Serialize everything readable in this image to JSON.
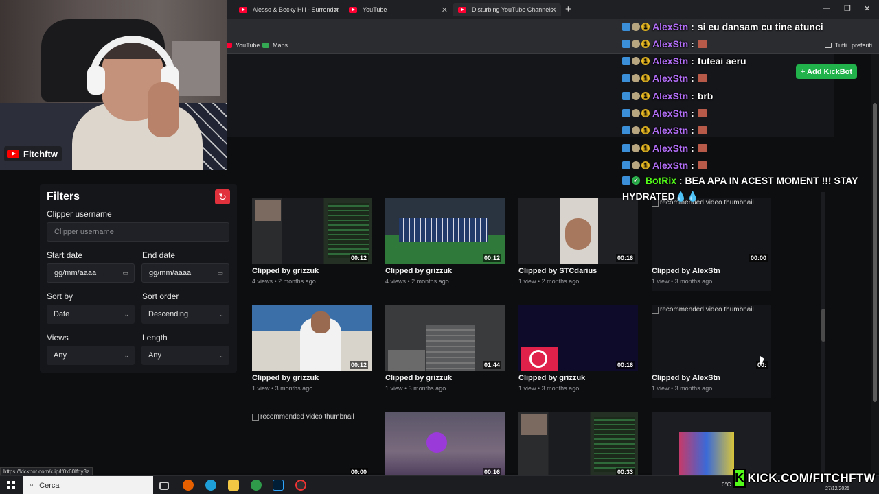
{
  "browser": {
    "tabs": [
      {
        "title": "Alesso & Becky Hill - Surrender"
      },
      {
        "title": "YouTube"
      },
      {
        "title": "Disturbing YouTube Channels I"
      }
    ],
    "bookmarks": [
      {
        "label": "YouTube"
      },
      {
        "label": "Maps"
      }
    ],
    "all_bookmarks": "Tutti i preferiti"
  },
  "webcam": {
    "channel_name": "Fitchftw"
  },
  "chat": {
    "messages": [
      {
        "user": "AlexStn",
        "text": "si eu dansam cu tine atunci",
        "emote": false
      },
      {
        "user": "AlexStn",
        "text": "",
        "emote": true
      },
      {
        "user": "AlexStn",
        "text": "futeai aeru",
        "emote": false
      },
      {
        "user": "AlexStn",
        "text": "",
        "emote": true
      },
      {
        "user": "AlexStn",
        "text": "brb",
        "emote": false
      },
      {
        "user": "AlexStn",
        "text": "",
        "emote": true
      },
      {
        "user": "AlexStn",
        "text": "",
        "emote": true
      },
      {
        "user": "AlexStn",
        "text": "",
        "emote": true
      },
      {
        "user": "AlexStn",
        "text": "",
        "emote": true
      }
    ],
    "bot": {
      "user": "BotRix",
      "text": "BEA APA IN ACEST MOMENT !!! STAY HYDRATED💧💧"
    },
    "user_color": "#b36ef7",
    "bot_color": "#53fc18"
  },
  "add_kickbot": "+ Add KickBot",
  "filters": {
    "title": "Filters",
    "clipper_label": "Clipper username",
    "clipper_placeholder": "Clipper username",
    "start_label": "Start date",
    "start_value": "gg/mm/aaaa",
    "end_label": "End date",
    "end_value": "gg/mm/aaaa",
    "sort_by_label": "Sort by",
    "sort_by_value": "Date",
    "sort_order_label": "Sort order",
    "sort_order_value": "Descending",
    "views_label": "Views",
    "views_value": "Any",
    "length_label": "Length",
    "length_value": "Any"
  },
  "clips": [
    {
      "by": "Clipped by grizzuk",
      "meta": "4 views • 2 months ago",
      "duration": "00:12",
      "thumb": "stream"
    },
    {
      "by": "Clipped by grizzuk",
      "meta": "4 views • 2 months ago",
      "duration": "00:12",
      "thumb": "stadium"
    },
    {
      "by": "Clipped by STCdarius",
      "meta": "1 view • 2 months ago",
      "duration": "00:16",
      "thumb": "face"
    },
    {
      "by": "Clipped by AlexStn",
      "meta": "1 view • 3 months ago",
      "duration": "00:00",
      "thumb": "broken"
    },
    {
      "by": "Clipped by grizzuk",
      "meta": "1 view • 3 months ago",
      "duration": "00:12",
      "thumb": "lakers"
    },
    {
      "by": "Clipped by grizzuk",
      "meta": "1 view • 3 months ago",
      "duration": "01:44",
      "thumb": "stairs"
    },
    {
      "by": "Clipped by grizzuk",
      "meta": "1 view • 3 months ago",
      "duration": "00:16",
      "thumb": "dark"
    },
    {
      "by": "Clipped by AlexStn",
      "meta": "1 view • 3 months ago",
      "duration": "00:",
      "thumb": "broken"
    },
    {
      "by": "",
      "meta": "",
      "duration": "00:00",
      "thumb": "broken"
    },
    {
      "by": "",
      "meta": "",
      "duration": "00:16",
      "thumb": "game"
    },
    {
      "by": "",
      "meta": "",
      "duration": "00:33",
      "thumb": "stream"
    },
    {
      "by": "",
      "meta": "",
      "duration": "",
      "thumb": "stage"
    }
  ],
  "broken_thumb_alt": "recommended video thumbnail",
  "status_url": "https://kickbot.com/clip/lf0x60lfdy3z",
  "taskbar": {
    "search": "Cerca",
    "temperature": "0°C",
    "date": "27/12/2025"
  },
  "kick_brand": "KICK.COM/FITCHFTW"
}
